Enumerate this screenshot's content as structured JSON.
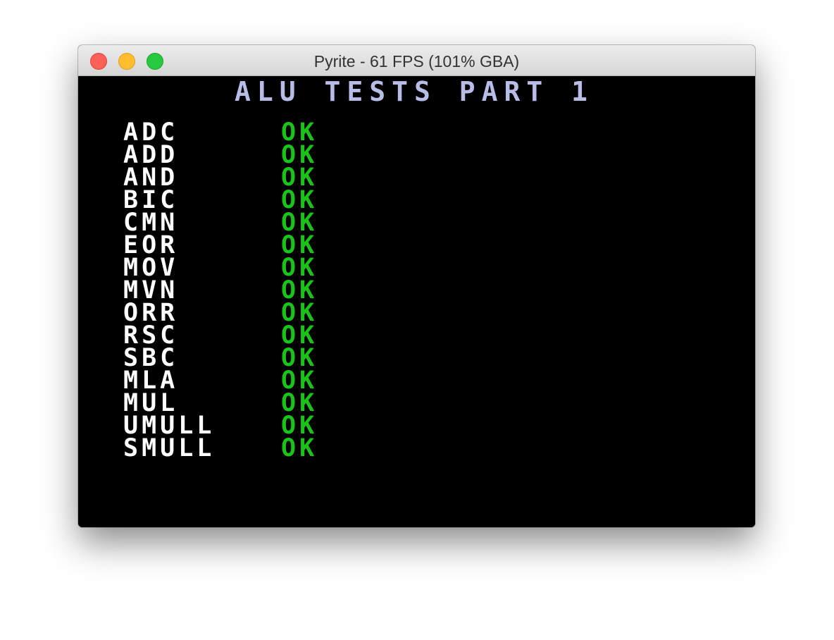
{
  "window": {
    "title": "Pyrite - 61 FPS (101% GBA)"
  },
  "screen": {
    "title": "ALU TESTS PART 1",
    "tests": [
      {
        "name": "ADC",
        "result": "OK"
      },
      {
        "name": "ADD",
        "result": "OK"
      },
      {
        "name": "AND",
        "result": "OK"
      },
      {
        "name": "BIC",
        "result": "OK"
      },
      {
        "name": "CMN",
        "result": "OK"
      },
      {
        "name": "EOR",
        "result": "OK"
      },
      {
        "name": "MOV",
        "result": "OK"
      },
      {
        "name": "MVN",
        "result": "OK"
      },
      {
        "name": "ORR",
        "result": "OK"
      },
      {
        "name": "RSC",
        "result": "OK"
      },
      {
        "name": "SBC",
        "result": "OK"
      },
      {
        "name": "MLA",
        "result": "OK"
      },
      {
        "name": "MUL",
        "result": "OK"
      },
      {
        "name": "UMULL",
        "result": "OK"
      },
      {
        "name": "SMULL",
        "result": "OK"
      }
    ]
  },
  "colors": {
    "title_text": "#b8bde8",
    "op_text": "#ffffff",
    "ok_text": "#19c419",
    "screen_bg": "#000000"
  }
}
